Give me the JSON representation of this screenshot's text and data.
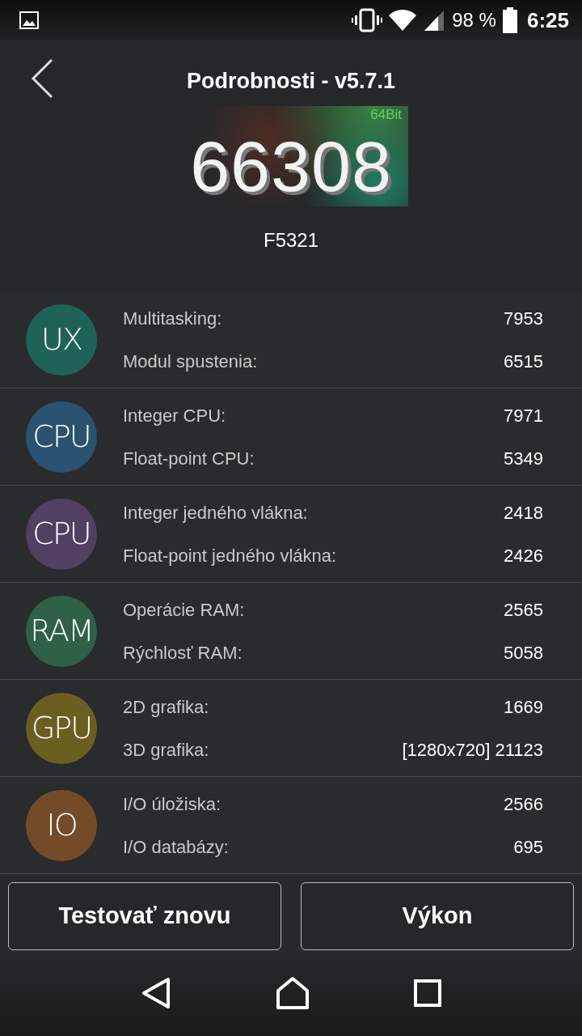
{
  "status_bar": {
    "battery": "98 %",
    "time": "6:25"
  },
  "header": {
    "title": "Podrobnosti - v5.7.1"
  },
  "score": {
    "value": "66308",
    "badge": "64Bit",
    "device": "F5321"
  },
  "categories": [
    {
      "label": "UX",
      "color": "#1e6259",
      "tests": [
        {
          "name": "Multitasking:",
          "value": "7953"
        },
        {
          "name": "Modul spustenia:",
          "value": "6515"
        }
      ]
    },
    {
      "label": "CPU",
      "color": "#2b5270",
      "tests": [
        {
          "name": "Integer CPU:",
          "value": "7971"
        },
        {
          "name": "Float-point CPU:",
          "value": "5349"
        }
      ]
    },
    {
      "label": "CPU",
      "color": "#533e64",
      "tests": [
        {
          "name": "Integer jedného vlákna:",
          "value": "2418"
        },
        {
          "name": "Float-point jedného vlákna:",
          "value": "2426"
        }
      ]
    },
    {
      "label": "RAM",
      "color": "#2e6145",
      "tests": [
        {
          "name": "Operácie RAM:",
          "value": "2565"
        },
        {
          "name": "Rýchlosť RAM:",
          "value": "5058"
        }
      ]
    },
    {
      "label": "GPU",
      "color": "#6b5e21",
      "tests": [
        {
          "name": "2D grafika:",
          "value": "1669"
        },
        {
          "name": "3D grafika:",
          "value": "[1280x720] 21123"
        }
      ]
    },
    {
      "label": "IO",
      "color": "#744b29",
      "tests": [
        {
          "name": "I/O úložiska:",
          "value": "2566"
        },
        {
          "name": "I/O databázy:",
          "value": "695"
        }
      ]
    }
  ],
  "buttons": [
    "Testovať znovu",
    "Výkon"
  ]
}
